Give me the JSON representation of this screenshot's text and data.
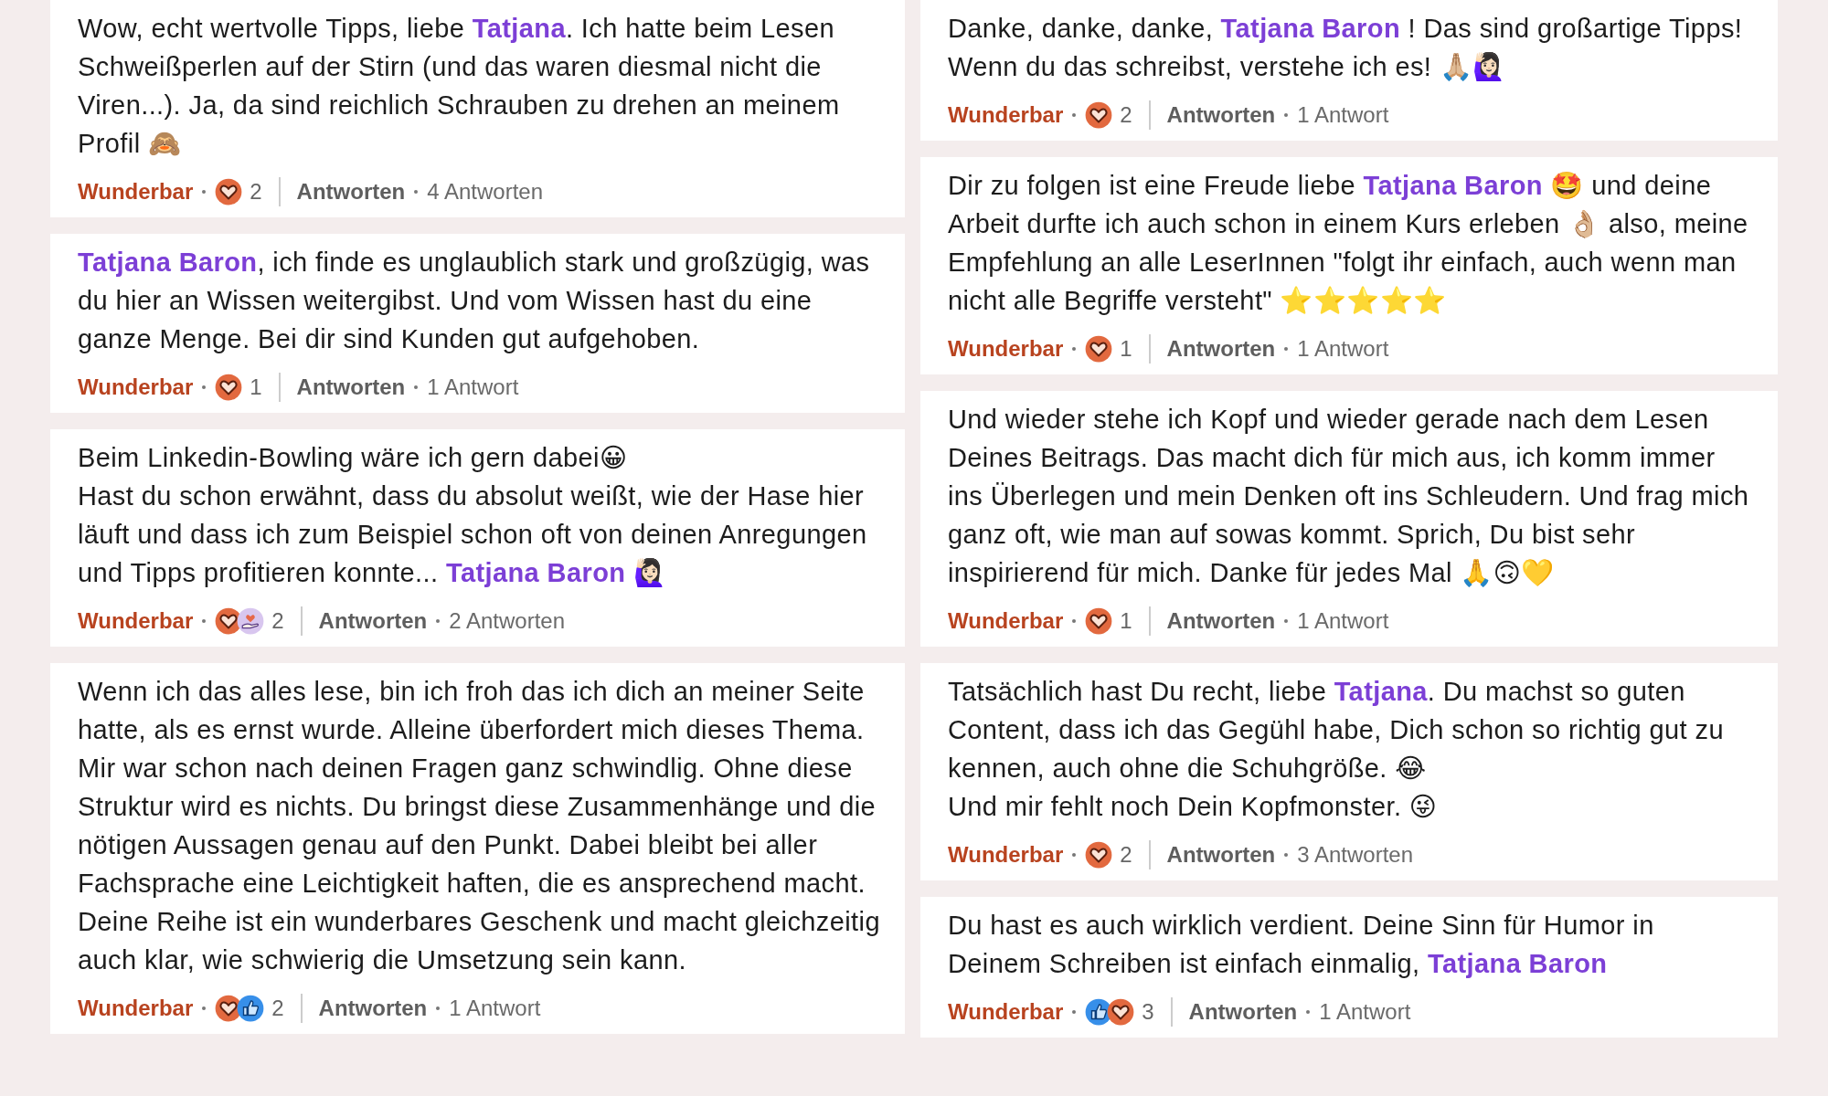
{
  "left_column": [
    {
      "paragraphs": [
        "Wow, echt wertvolle Tipps, liebe **Tatjana**. Ich hatte beim Lesen Schweißperlen auf der Stirn (und das waren diesmal nicht die Viren...). Ja, da sind reichlich Schrauben zu drehen an meinem Profil 🙈"
      ],
      "reaction_label": "Wunderbar",
      "reactions": [
        {
          "kind": "heart"
        }
      ],
      "reaction_count": "2",
      "reply_button": "Antworten",
      "replies": "4 Antworten"
    },
    {
      "paragraphs": [
        "**Tatjana Baron**, ich finde es unglaublich stark und großzügig, was du hier an Wissen weitergibst. Und vom Wissen hast du eine ganze Menge. Bei dir sind Kunden gut aufgehoben."
      ],
      "reaction_label": "Wunderbar",
      "reactions": [
        {
          "kind": "heart"
        }
      ],
      "reaction_count": "1",
      "reply_button": "Antworten",
      "replies": "1 Antwort"
    },
    {
      "paragraphs": [
        "Beim Linkedin-Bowling wäre ich gern dabei😀",
        "Hast du schon erwähnt, dass du absolut weißt, wie der Hase hier läuft und dass ich zum Beispiel schon oft von deinen Anregungen und Tipps profitieren konnte... **Tatjana Baron** 🙋🏻‍♀️"
      ],
      "reaction_label": "Wunderbar",
      "reactions": [
        {
          "kind": "heart"
        },
        {
          "kind": "support"
        }
      ],
      "reaction_count": "2",
      "reply_button": "Antworten",
      "replies": "2 Antworten"
    },
    {
      "paragraphs": [
        "Wenn ich das alles lese, bin ich froh das ich dich an meiner Seite hatte, als es ernst wurde. Alleine überfordert mich dieses Thema. Mir war schon nach deinen Fragen ganz schwindlig. Ohne diese Struktur wird es nichts. Du bringst diese Zusammenhänge und die nötigen Aussagen genau auf den Punkt. Dabei bleibt bei aller Fachsprache eine Leichtigkeit haften, die es ansprechend macht. Deine Reihe ist ein wunderbares Geschenk und macht gleichzeitig auch klar, wie schwierig die Umsetzung sein kann."
      ],
      "reaction_label": "Wunderbar",
      "reactions": [
        {
          "kind": "heart"
        },
        {
          "kind": "like"
        }
      ],
      "reaction_count": "2",
      "reply_button": "Antworten",
      "replies": "1 Antwort"
    }
  ],
  "right_column": [
    {
      "paragraphs": [
        "Danke, danke, danke, **Tatjana Baron** ! Das sind großartige Tipps! Wenn du das schreibst, verstehe ich es! 🙏🏼🙋🏻‍♀️"
      ],
      "reaction_label": "Wunderbar",
      "reactions": [
        {
          "kind": "heart"
        }
      ],
      "reaction_count": "2",
      "reply_button": "Antworten",
      "replies": "1 Antwort"
    },
    {
      "paragraphs": [
        "Dir zu folgen ist eine Freude liebe **Tatjana Baron** 🤩 und deine Arbeit durfte ich auch schon in einem Kurs erleben 👌🏼 also, meine Empfehlung an alle LeserInnen \"folgt ihr einfach, auch wenn man nicht alle Begriffe versteht\" ⭐⭐⭐⭐⭐"
      ],
      "reaction_label": "Wunderbar",
      "reactions": [
        {
          "kind": "heart"
        }
      ],
      "reaction_count": "1",
      "reply_button": "Antworten",
      "replies": "1 Antwort"
    },
    {
      "paragraphs": [
        "Und wieder stehe ich Kopf und wieder gerade nach dem Lesen Deines Beitrags. Das macht dich für mich aus, ich komm immer ins Überlegen und mein Denken oft ins Schleudern. Und frag mich ganz oft, wie man auf sowas kommt. Sprich, Du bist sehr inspirierend für mich. Danke für jedes Mal 🙏🙃💛"
      ],
      "reaction_label": "Wunderbar",
      "reactions": [
        {
          "kind": "heart"
        }
      ],
      "reaction_count": "1",
      "reply_button": "Antworten",
      "replies": "1 Antwort"
    },
    {
      "paragraphs": [
        "Tatsächlich hast Du recht, liebe **Tatjana**. Du machst so guten Content, dass ich das Gegühl habe, Dich schon so richtig gut zu kennen, auch ohne die Schuhgröße. 😂",
        "Und mir fehlt noch Dein Kopfmonster. 😜"
      ],
      "reaction_label": "Wunderbar",
      "reactions": [
        {
          "kind": "heart"
        }
      ],
      "reaction_count": "2",
      "reply_button": "Antworten",
      "replies": "3 Antworten"
    },
    {
      "paragraphs": [
        "Du hast es auch wirklich verdient. Deine Sinn für Humor in Deinem Schreiben ist einfach einmalig, **Tatjana Baron**"
      ],
      "reaction_label": "Wunderbar",
      "reactions": [
        {
          "kind": "like"
        },
        {
          "kind": "heart"
        }
      ],
      "reaction_count": "3",
      "reply_button": "Antworten",
      "replies": "1 Antwort"
    }
  ]
}
